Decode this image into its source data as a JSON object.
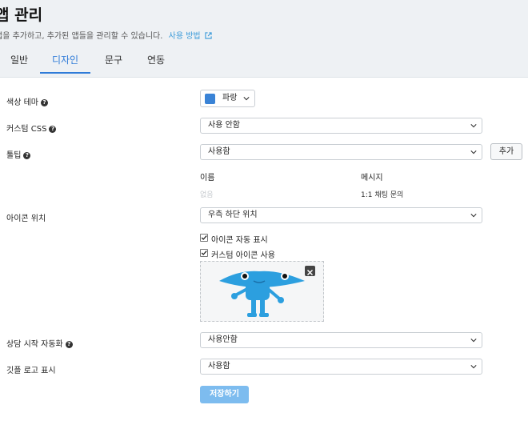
{
  "header": {
    "title": "앱 관리",
    "subtitle": "앱을 추가하고, 추가된 앱들을 관리할 수 있습니다.",
    "help_link": "사용 방법"
  },
  "tabs": [
    {
      "label": "일반",
      "active": false
    },
    {
      "label": "디자인",
      "active": true
    },
    {
      "label": "문구",
      "active": false
    },
    {
      "label": "연동",
      "active": false
    }
  ],
  "form": {
    "color_theme": {
      "label": "색상 테마",
      "value": "파랑",
      "swatch": "#3a83d6"
    },
    "custom_css": {
      "label": "커스텀 CSS",
      "value": "사용 안함"
    },
    "tooltip": {
      "label": "툴팁",
      "value": "사용함",
      "add_label": "추가"
    },
    "tooltip_table": {
      "columns": [
        "이름",
        "메시지"
      ],
      "rows": [
        {
          "name": "없음",
          "message": "1:1 채팅 문의"
        }
      ]
    },
    "icon_position": {
      "label": "아이콘 위치",
      "value": "우측 하단 위치",
      "options": [
        {
          "label": "아이콘 자동 표시",
          "checked": true
        },
        {
          "label": "커스텀 아이콘 사용",
          "checked": true
        }
      ]
    },
    "auto_start": {
      "label": "상담 시작 자동화",
      "value": "사용안함"
    },
    "show_logo": {
      "label": "깃플 로고 표시",
      "value": "사용함"
    },
    "save_label": "저장하기"
  },
  "colors": {
    "accent": "#2f7bd8",
    "save_button": "#7dbcef",
    "mascot": "#2c9fdf"
  }
}
